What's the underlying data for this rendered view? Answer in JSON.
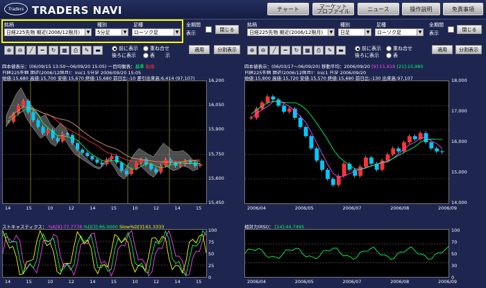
{
  "header": {
    "logo_text": "Traders",
    "title": "TRADERS NAVI",
    "nav": [
      "チャート",
      "マーケット\nプロファイル",
      "ニュース",
      "操作説明",
      "免責事項"
    ]
  },
  "left_panel": {
    "labels": {
      "symbol": "銘柄",
      "kind": "種別",
      "foot": "足種",
      "all_period": "全期間",
      "display": "表示"
    },
    "symbol_value": "日経225先物  期近(2006/12限月)",
    "kind_value": "5分足",
    "foot_value": "ローソク足",
    "close_label": "閉じる",
    "apply_label": "適用",
    "split_label": "分割表示",
    "front_label": "前に表示",
    "back_label": "後ろに表示",
    "overlay_label": "重ね合せ",
    "show_label": "表",
    "show_label2": "示",
    "info1": "四本値表示：(06/09/15 13:50～06/09/20 15:05)  一目均衡表：",
    "legend_base": "基準",
    "legend_conv": "転換",
    "info2": "日経225先物 期近(2006/12限月)：Jnic1 5分足 2006/09/20 15:05",
    "info3": "始値:15,680 高値:15,700 安値:15,670 終値:15,680 前日比:-10 差引出来高:6,414 (97,107)",
    "yticks": [
      "16,200",
      "16,050",
      "15,900",
      "15,750",
      "15,600",
      "15,450"
    ],
    "xticks": [
      "14",
      "15",
      "10",
      "12",
      "14",
      "15",
      "10",
      "12",
      "14",
      "15"
    ],
    "stoch_title": "ストキャスティクス：",
    "stoch_k": "%K[9]:77.7778",
    "stoch_d": "%D[3]:86.0000",
    "stoch_sd": "Slow%D[3]:61.3333",
    "stoch_yticks": [
      "100",
      "75",
      "50",
      "25",
      "0"
    ]
  },
  "right_panel": {
    "symbol_value": "日経225先物  期近(2006/12限月)",
    "kind_value": "日足",
    "foot_value": "ローソク足",
    "info1": "四本値表示：(06/03/17～06/09/20)  移動平均：2006/09/20",
    "ma1": "[9]:15,818",
    "ma2": "[21]:15,980",
    "info2": "日経225先物 期近(2006/12限月)：Jnic1 日足 2006/09/20",
    "info3": "始値:15,800 高値:15,720 安値:15,570 終値:15,680 前日比:-130 出来高:97,107",
    "yticks": [
      "18,000",
      "17,000",
      "16,000",
      "15,000",
      "14,000"
    ],
    "xticks": [
      "2006/04",
      "2006/05",
      "2006/07",
      "2006/08",
      "2006/09"
    ],
    "rsi_title": "相対力(RSI)：",
    "rsi_value": "[14]:44.7495",
    "rsi_yticks": [
      "100",
      "70",
      "50",
      "30",
      "0"
    ]
  },
  "chart_data": [
    {
      "type": "candlestick",
      "title": "日経225先物 期近(2006/12限月) 5分足",
      "ylim": [
        15450,
        16200
      ],
      "x_ticks": [
        "14",
        "15",
        "10",
        "12",
        "14",
        "15",
        "10",
        "12",
        "14",
        "15"
      ],
      "close": [
        15950,
        16000,
        16050,
        16080,
        16010,
        15960,
        15920,
        15880,
        15900,
        15850,
        15830,
        15880,
        15870,
        15820,
        15780,
        15760,
        15740,
        15720,
        15700,
        15690,
        15720,
        15740,
        15700,
        15650,
        15630,
        15660,
        15700,
        15720,
        15690,
        15660,
        15640,
        15680,
        15720,
        15700,
        15680,
        15690,
        15710,
        15700,
        15680,
        15690
      ]
    },
    {
      "type": "candlestick",
      "title": "日経225先物 期近(2006/12限月) 日足",
      "ylim": [
        14000,
        18000
      ],
      "x_ticks": [
        "2006/04",
        "2006/05",
        "2006/07",
        "2006/08",
        "2006/09"
      ],
      "close": [
        16800,
        17100,
        17300,
        17500,
        17400,
        17200,
        17000,
        17100,
        16800,
        16500,
        16200,
        15800,
        15400,
        15100,
        14800,
        14600,
        14900,
        15300,
        15100,
        14900,
        15200,
        15500,
        15300,
        15100,
        15400,
        15600,
        15800,
        15700,
        16000,
        16200,
        16100,
        16300,
        16000,
        15800,
        15700,
        15680
      ]
    }
  ],
  "colors": {
    "accent": "#ffff00",
    "background": "#1e2650",
    "base_line": "#00ff66",
    "conv_line": "#ff3333"
  }
}
